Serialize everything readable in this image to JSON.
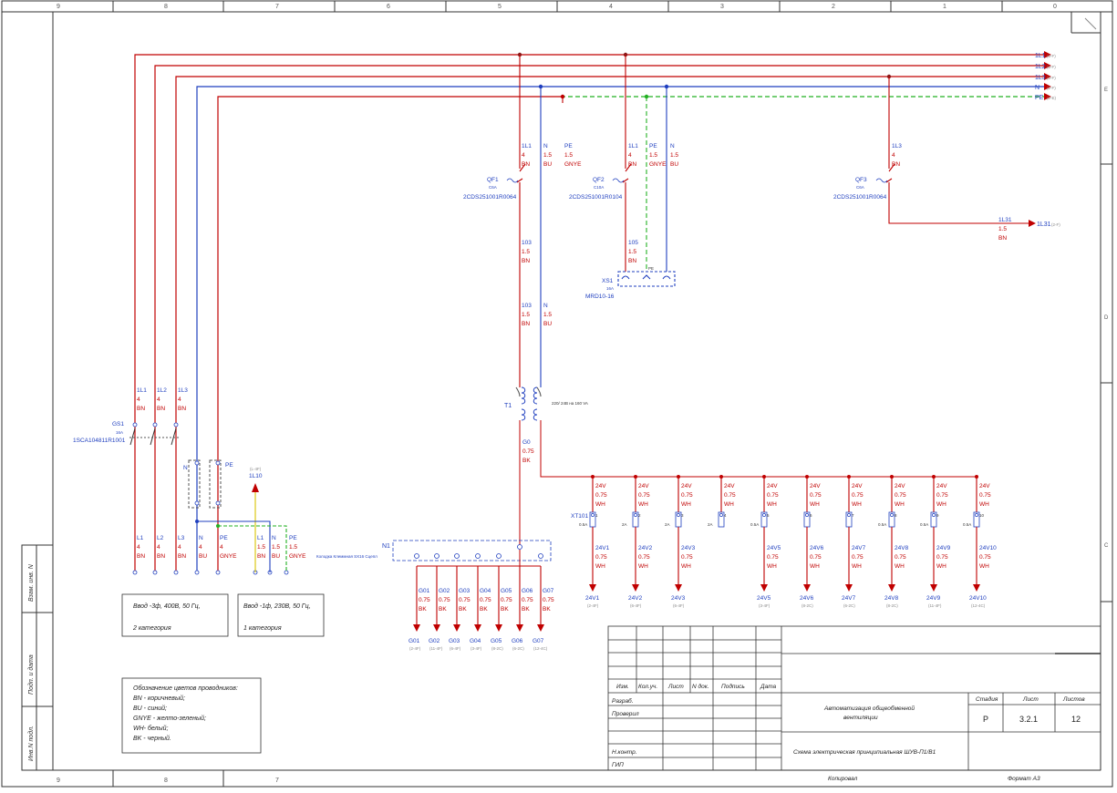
{
  "frame": {
    "top_numbers": [
      "9",
      "8",
      "7",
      "6",
      "5",
      "4",
      "3",
      "2",
      "1",
      "0"
    ],
    "right_letters": [
      "E",
      "D",
      "C"
    ],
    "bottom_numbers": [
      "9",
      "8",
      "7"
    ],
    "side_labels": [
      "Взам. инв. N",
      "Подп. и дата",
      "Инв.N подл."
    ]
  },
  "buses": [
    {
      "name": "1L1",
      "ref": "(3-F)"
    },
    {
      "name": "1L2",
      "ref": "(3-F)"
    },
    {
      "name": "1L3",
      "ref": "(3-F)"
    },
    {
      "name": "N",
      "ref": "(2-F)"
    },
    {
      "name": "PE",
      "ref": "(2-E)"
    }
  ],
  "wire_labels": {
    "qf1_1l1": {
      "name": "1L1",
      "size": "4",
      "color": "BN"
    },
    "qf1_n": {
      "name": "N",
      "size": "1.5",
      "color": "BU"
    },
    "qf1_pe": {
      "name": "PE",
      "size": "1.5",
      "color": "GNYE"
    },
    "qf2_1l1": {
      "name": "1L1",
      "size": "4",
      "color": "BN"
    },
    "qf2_pe": {
      "name": "PE",
      "size": "1.5",
      "color": "GNYE"
    },
    "qf2_n": {
      "name": "N",
      "size": "1.5",
      "color": "BU"
    },
    "qf3_1l3": {
      "name": "1L3",
      "size": "4",
      "color": "BN"
    },
    "w103a": {
      "name": "103",
      "size": "1.5",
      "color": "BN"
    },
    "w103b": {
      "name": "103",
      "size": "1.5",
      "color": "BN"
    },
    "w103n": {
      "name": "N",
      "size": "1.5",
      "color": "BU"
    },
    "w105": {
      "name": "105",
      "size": "1.5",
      "color": "BN"
    },
    "w1l31": {
      "name": "1L31",
      "size": "1.5",
      "color": "BN"
    },
    "g0": {
      "name": "G0",
      "size": "0.75",
      "color": "BK"
    },
    "gs_1l1": {
      "name": "1L1",
      "size": "4",
      "color": "BN"
    },
    "gs_1l2": {
      "name": "1L2",
      "size": "4",
      "color": "BN"
    },
    "gs_1l3": {
      "name": "1L3",
      "size": "4",
      "color": "BN"
    },
    "in_l1": {
      "name": "L1",
      "size": "4",
      "color": "BN"
    },
    "in_l2": {
      "name": "L2",
      "size": "4",
      "color": "BN"
    },
    "in_l3": {
      "name": "L3",
      "size": "4",
      "color": "BN"
    },
    "in_n": {
      "name": "N",
      "size": "4",
      "color": "BU"
    },
    "in_pe": {
      "name": "PE",
      "size": "4",
      "color": "GNYE"
    },
    "in1_l1": {
      "name": "L1",
      "size": "1.5",
      "color": "BN"
    },
    "in1_n": {
      "name": "N",
      "size": "1.5",
      "color": "BU"
    },
    "in1_pe": {
      "name": "PE",
      "size": "1.5",
      "color": "GNYE"
    }
  },
  "devices": {
    "qf1": {
      "tag": "QF1",
      "rating": "C6A",
      "code": "2CDS251001R0064"
    },
    "qf2": {
      "tag": "QF2",
      "rating": "C10A",
      "code": "2CDS251001R0104"
    },
    "qf3": {
      "tag": "QF3",
      "rating": "C6A",
      "code": "2CDS251001R0064"
    },
    "xs1": {
      "tag": "XS1",
      "rating": "16A",
      "code": "MRD10-16",
      "pe": "PE"
    },
    "gs1": {
      "tag": "GS1",
      "rating": "16A",
      "code": "1SCA104811R1001"
    },
    "t1": {
      "tag": "T1",
      "spec": "220/ 24В на 160 VA"
    },
    "xt101": {
      "tag": "XT101"
    },
    "n1": {
      "tag": "N1",
      "desc": "Колодка Клеммная SX16 Сцепл"
    },
    "gs_n": "N",
    "gs_pe": "PE",
    "out_1l31": {
      "name": "1L31",
      "ref": "(2-F)"
    },
    "out_1l10": {
      "name": "1L10",
      "ref": "(L-4F)"
    }
  },
  "fuse_rating_5A": "0.5A",
  "fuse_rating_2A": "2A",
  "v24_branches": [
    {
      "num": "1",
      "fuse": "0.5A",
      "top": "24V",
      "mid": "24V1",
      "ref": "(2-4F)"
    },
    {
      "num": "2",
      "fuse": "2A",
      "top": "24V",
      "mid": "24V2",
      "ref": "(6-4F)"
    },
    {
      "num": "3",
      "fuse": "2A",
      "top": "24V",
      "mid": "24V3",
      "ref": "(6-4F)"
    },
    {
      "num": "4",
      "fuse": "2A",
      "top": "24V",
      "mid": "",
      "ref": ""
    },
    {
      "num": "5",
      "fuse": "0.5A",
      "top": "24V",
      "mid": "24V5",
      "ref": "(3-4F)"
    },
    {
      "num": "6",
      "fuse": "",
      "top": "24V",
      "mid": "24V6",
      "ref": "(8-2C)"
    },
    {
      "num": "7",
      "fuse": "",
      "top": "24V",
      "mid": "24V7",
      "ref": "(6-2C)"
    },
    {
      "num": "8",
      "fuse": "0.5A",
      "top": "24V",
      "mid": "24V8",
      "ref": "(8-2C)"
    },
    {
      "num": "9",
      "fuse": "0.5A",
      "top": "24V",
      "mid": "24V9",
      "ref": "(11-4F)"
    },
    {
      "num": "10",
      "fuse": "0.5A",
      "top": "24V",
      "mid": "24V10",
      "ref": "(12-4C)"
    }
  ],
  "wire_size_075": "0.75",
  "wire_color_wh": "WH",
  "wire_color_bk": "BK",
  "g_branches": [
    {
      "name": "G01",
      "ref": "(2-4F)"
    },
    {
      "name": "G02",
      "ref": "(11-4F)"
    },
    {
      "name": "G03",
      "ref": "(6-4F)"
    },
    {
      "name": "G04",
      "ref": "(3-4F)"
    },
    {
      "name": "G05",
      "ref": "(8-2C)"
    },
    {
      "name": "G06",
      "ref": "(6-2C)"
    },
    {
      "name": "G07",
      "ref": "(12-4C)"
    }
  ],
  "inputs": {
    "three_phase": {
      "line1": "Ввод -3ф, 400В, 50 Гц,",
      "line2": "2 категория"
    },
    "single_phase": {
      "line1": "Ввод -1ф, 230В, 50 Гц,",
      "line2": "1 категория"
    }
  },
  "legend": {
    "title": "Обозначение цветов проводников:",
    "lines": [
      "BN - коричневый;",
      "BU - синий;",
      "GNYE - желто-зеленый;",
      "WH- белый;",
      "BK - черный."
    ]
  },
  "title_block": {
    "headers": [
      "Изм.",
      "Кол.уч.",
      "Лист",
      "N док.",
      "Подпись",
      "Дата"
    ],
    "roles": [
      "Разраб.",
      "Проверил",
      "",
      "",
      "Н.контр.",
      "ГИП"
    ],
    "project": [
      "Автоматизация общеобменной",
      "вентиляции"
    ],
    "drawing": "Схема электрическая принципиальная ШУВ-П1/В1",
    "stage_label": "Стадия",
    "sheet_label": "Лист",
    "sheets_label": "Листов",
    "stage": "Р",
    "sheet": "3.2.1",
    "sheets": "12",
    "copied": "Копировал",
    "format": "Формат  А3"
  },
  "colors": {
    "phase": "#c00000",
    "neutral": "#1f3fbf",
    "pe": "#22b022",
    "control": "#c00000",
    "gnd": "#111111"
  }
}
